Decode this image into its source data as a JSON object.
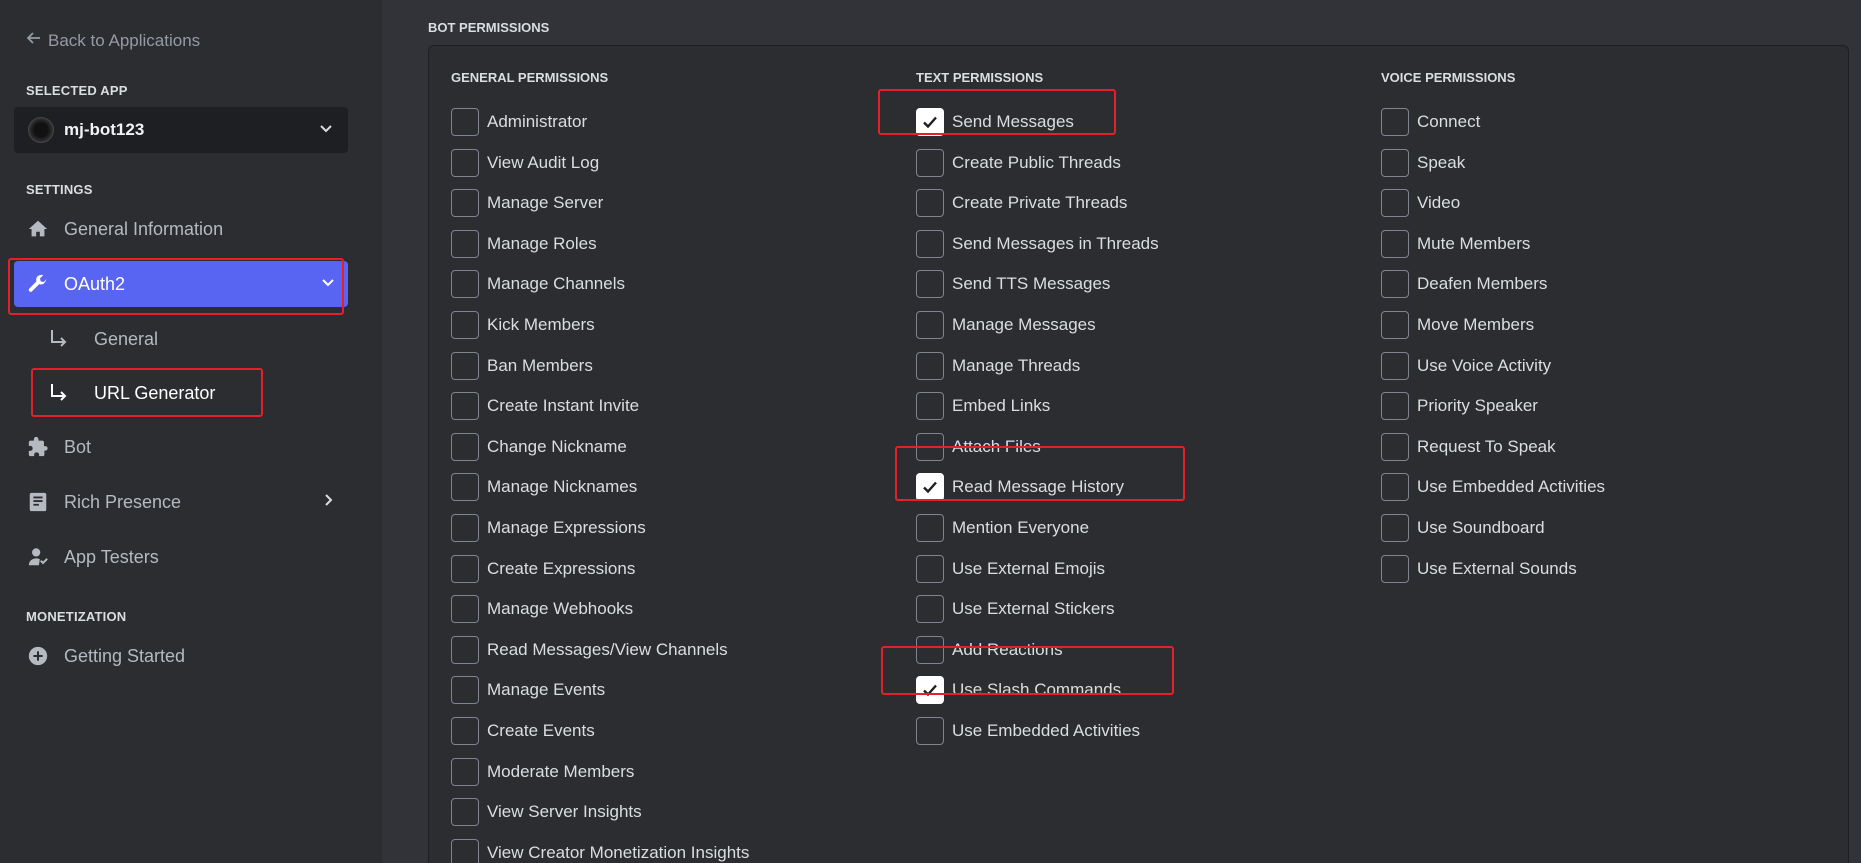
{
  "sidebar": {
    "back_label": "Back to Applications",
    "selected_app_heading": "SELECTED APP",
    "app_name": "mj-bot123",
    "settings_heading": "SETTINGS",
    "nav": {
      "general_information": "General Information",
      "oauth2": "OAuth2",
      "oauth2_general": "General",
      "url_generator": "URL Generator",
      "bot": "Bot",
      "rich_presence": "Rich Presence",
      "app_testers": "App Testers"
    },
    "monetization_heading": "MONETIZATION",
    "getting_started": "Getting Started"
  },
  "main": {
    "title": "BOT PERMISSIONS",
    "columns": [
      {
        "title": "GENERAL PERMISSIONS",
        "items": [
          {
            "label": "Administrator",
            "checked": false
          },
          {
            "label": "View Audit Log",
            "checked": false
          },
          {
            "label": "Manage Server",
            "checked": false
          },
          {
            "label": "Manage Roles",
            "checked": false
          },
          {
            "label": "Manage Channels",
            "checked": false
          },
          {
            "label": "Kick Members",
            "checked": false
          },
          {
            "label": "Ban Members",
            "checked": false
          },
          {
            "label": "Create Instant Invite",
            "checked": false
          },
          {
            "label": "Change Nickname",
            "checked": false
          },
          {
            "label": "Manage Nicknames",
            "checked": false
          },
          {
            "label": "Manage Expressions",
            "checked": false
          },
          {
            "label": "Create Expressions",
            "checked": false
          },
          {
            "label": "Manage Webhooks",
            "checked": false
          },
          {
            "label": "Read Messages/View Channels",
            "checked": false
          },
          {
            "label": "Manage Events",
            "checked": false
          },
          {
            "label": "Create Events",
            "checked": false
          },
          {
            "label": "Moderate Members",
            "checked": false
          },
          {
            "label": "View Server Insights",
            "checked": false
          },
          {
            "label": "View Creator Monetization Insights",
            "checked": false
          }
        ]
      },
      {
        "title": "TEXT PERMISSIONS",
        "items": [
          {
            "label": "Send Messages",
            "checked": true
          },
          {
            "label": "Create Public Threads",
            "checked": false
          },
          {
            "label": "Create Private Threads",
            "checked": false
          },
          {
            "label": "Send Messages in Threads",
            "checked": false
          },
          {
            "label": "Send TTS Messages",
            "checked": false
          },
          {
            "label": "Manage Messages",
            "checked": false
          },
          {
            "label": "Manage Threads",
            "checked": false
          },
          {
            "label": "Embed Links",
            "checked": false
          },
          {
            "label": "Attach Files",
            "checked": false
          },
          {
            "label": "Read Message History",
            "checked": true
          },
          {
            "label": "Mention Everyone",
            "checked": false
          },
          {
            "label": "Use External Emojis",
            "checked": false
          },
          {
            "label": "Use External Stickers",
            "checked": false
          },
          {
            "label": "Add Reactions",
            "checked": false
          },
          {
            "label": "Use Slash Commands",
            "checked": true
          },
          {
            "label": "Use Embedded Activities",
            "checked": false
          }
        ]
      },
      {
        "title": "VOICE PERMISSIONS",
        "items": [
          {
            "label": "Connect",
            "checked": false
          },
          {
            "label": "Speak",
            "checked": false
          },
          {
            "label": "Video",
            "checked": false
          },
          {
            "label": "Mute Members",
            "checked": false
          },
          {
            "label": "Deafen Members",
            "checked": false
          },
          {
            "label": "Move Members",
            "checked": false
          },
          {
            "label": "Use Voice Activity",
            "checked": false
          },
          {
            "label": "Priority Speaker",
            "checked": false
          },
          {
            "label": "Request To Speak",
            "checked": false
          },
          {
            "label": "Use Embedded Activities",
            "checked": false
          },
          {
            "label": "Use Soundboard",
            "checked": false
          },
          {
            "label": "Use External Sounds",
            "checked": false
          }
        ]
      }
    ]
  },
  "colors": {
    "accent": "#5865f2",
    "highlight_box": "#e5202a"
  }
}
